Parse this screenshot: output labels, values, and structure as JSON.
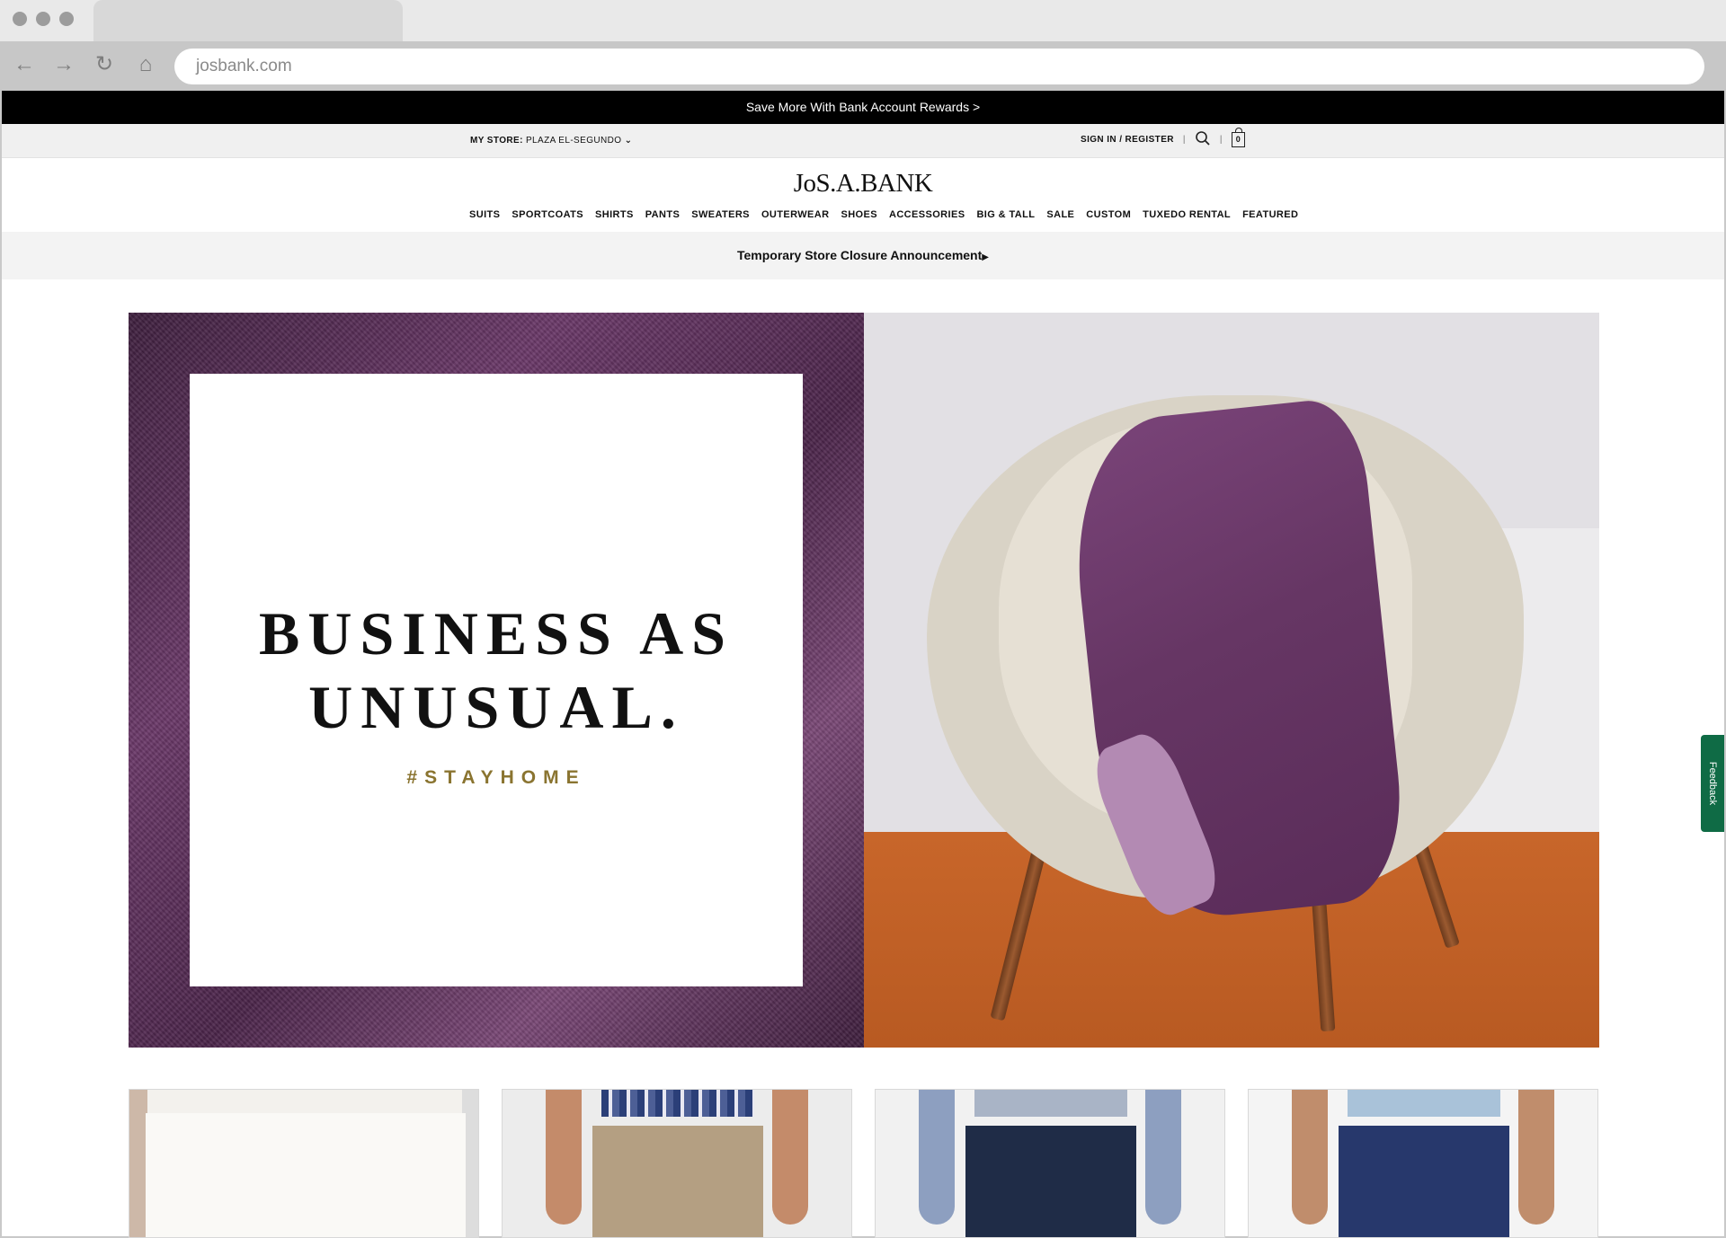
{
  "browser": {
    "url": "josbank.com"
  },
  "promo": {
    "text": "Save More With Bank Account Rewards >"
  },
  "utility": {
    "store_label": "MY STORE:",
    "store_value": "PLAZA EL-SEGUNDO",
    "sign_in": "SIGN IN / REGISTER",
    "separator": "|",
    "cart_count": "0"
  },
  "header": {
    "logo": "JoS.A.BANK",
    "nav": [
      "SUITS",
      "SPORTCOATS",
      "SHIRTS",
      "PANTS",
      "SWEATERS",
      "OUTERWEAR",
      "SHOES",
      "ACCESSORIES",
      "BIG & TALL",
      "SALE",
      "CUSTOM",
      "TUXEDO RENTAL",
      "FEATURED"
    ]
  },
  "announcement": {
    "text": "Temporary Store Closure Announcement"
  },
  "hero": {
    "headline_line1": "BUSINESS AS",
    "headline_line2": "UNUSUAL.",
    "hashtag": "#STAYHOME"
  },
  "feedback": {
    "label": "Feedback"
  },
  "colors": {
    "promo_bg": "#000000",
    "accent_gold": "#8a7430",
    "feedback_green": "#0f6b45",
    "fabric_purple": "#5a2c59"
  }
}
